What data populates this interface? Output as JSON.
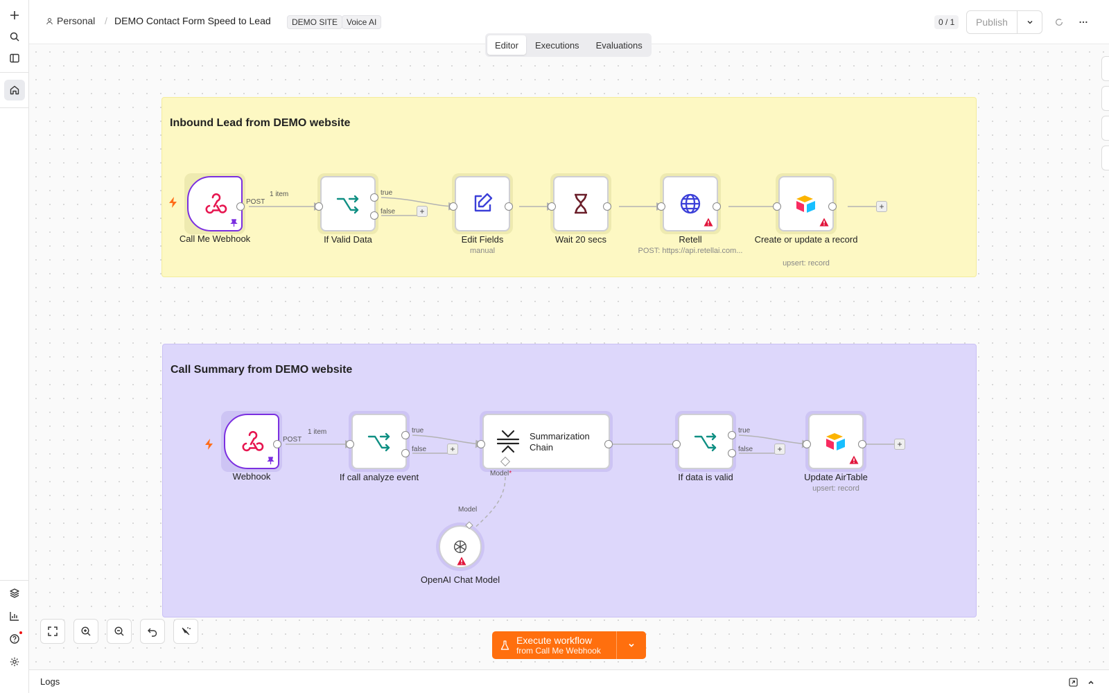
{
  "header": {
    "workspace": "Personal",
    "separator": "/",
    "workflow_name": "DEMO Contact Form Speed to Lead",
    "tags": [
      "DEMO SITE",
      "Voice AI"
    ],
    "counter": "0 / 1",
    "publish_label": "Publish"
  },
  "tabs": [
    {
      "label": "Editor",
      "active": true
    },
    {
      "label": "Executions",
      "active": false
    },
    {
      "label": "Evaluations",
      "active": false
    }
  ],
  "sticky_notes": [
    {
      "title": "Inbound Lead from DEMO website",
      "color": "#fdf8c3"
    },
    {
      "title": "Call Summary from DEMO website",
      "color": "#ddd7fb"
    }
  ],
  "workflow1": {
    "nodes": [
      {
        "label": "Call Me Webhook",
        "sub": ""
      },
      {
        "label": "If Valid Data",
        "sub": ""
      },
      {
        "label": "Edit Fields",
        "sub": "manual"
      },
      {
        "label": "Wait 20 secs",
        "sub": ""
      },
      {
        "label": "Retell",
        "sub": "POST: https://api.retellai.com..."
      },
      {
        "label": "Create or update a record",
        "sub": "upsert: record"
      }
    ],
    "edge_post": "POST",
    "edge_items": "1 item",
    "edge_true": "true",
    "edge_false": "false"
  },
  "workflow2": {
    "nodes": [
      {
        "label": "Webhook",
        "sub": ""
      },
      {
        "label": "If call analyze event",
        "sub": ""
      },
      {
        "label": "Summarization Chain",
        "sub": ""
      },
      {
        "label": "If data is valid",
        "sub": ""
      },
      {
        "label": "Update AirTable",
        "sub": "upsert: record"
      },
      {
        "label": "OpenAI Chat Model",
        "sub": ""
      }
    ],
    "edge_post": "POST",
    "edge_items": "1 item",
    "edge_true": "true",
    "edge_false": "false",
    "model_port_label": "Model",
    "model_required_marker": "*",
    "model_input_label": "Model"
  },
  "execute": {
    "label": "Execute workflow",
    "sublabel": "from Call Me Webhook"
  },
  "logs": {
    "label": "Logs"
  },
  "colors": {
    "accent": "#ff6f0e",
    "trigger_border": "#7b2fe0",
    "webhook_icon": "#e6154f",
    "if_icon": "#0f8f83",
    "warning": "#e1163c"
  },
  "icons": {
    "rail": [
      "plus-icon",
      "search-icon",
      "sidebar-icon",
      "home-icon",
      "templates-icon",
      "insights-icon",
      "help-icon",
      "settings-icon"
    ],
    "canvas_right": [
      "plus-icon",
      "search-icon",
      "sticky-note-icon",
      "panel-icon"
    ],
    "canvas_bottom": [
      "fit-view-icon",
      "zoom-in-icon",
      "zoom-out-icon",
      "undo-icon",
      "clean-up-icon"
    ]
  }
}
